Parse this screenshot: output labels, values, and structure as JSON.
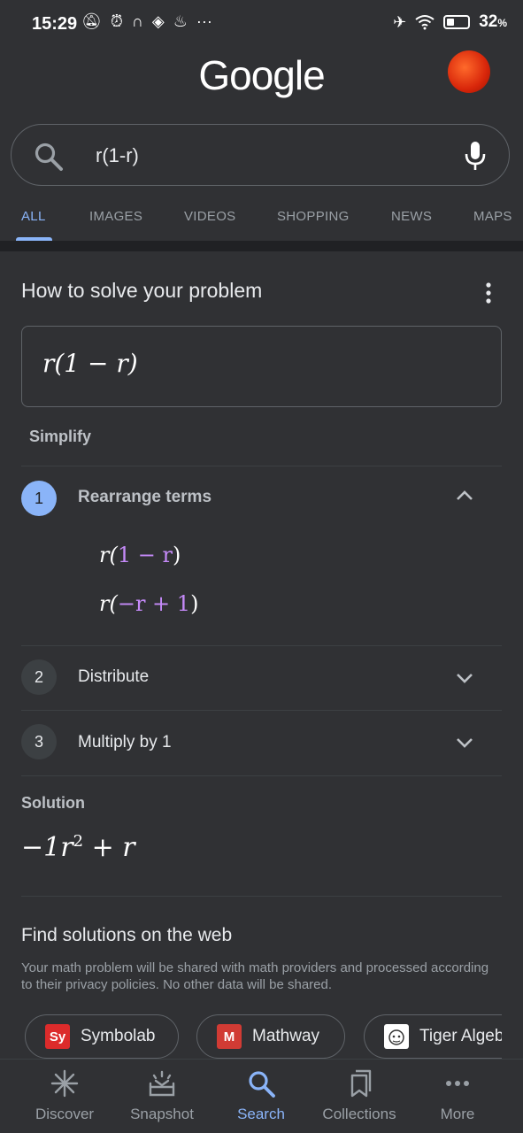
{
  "status_bar": {
    "time": "15:29",
    "battery": "32",
    "battery_unit": "%"
  },
  "header": {
    "logo": "Google"
  },
  "search": {
    "query": "r(1-r)"
  },
  "tabs": [
    {
      "label": "ALL",
      "active": true
    },
    {
      "label": "IMAGES"
    },
    {
      "label": "VIDEOS"
    },
    {
      "label": "SHOPPING"
    },
    {
      "label": "NEWS"
    },
    {
      "label": "MAPS"
    }
  ],
  "solver": {
    "title": "How to solve your problem",
    "expression": "r(1 − r)",
    "mode": "Simplify",
    "steps": [
      {
        "number": "1",
        "label": "Rearrange terms",
        "expanded": true,
        "line1_a": "r(",
        "line1_b": "1 − r",
        "line1_c": ")",
        "line2_a": "r(",
        "line2_b": "−r + 1",
        "line2_c": ")"
      },
      {
        "number": "2",
        "label": "Distribute",
        "expanded": false
      },
      {
        "number": "3",
        "label": "Multiply by 1",
        "expanded": false
      }
    ],
    "solution_label": "Solution",
    "solution_a": "−1r",
    "solution_exp": "2",
    "solution_b": " + r"
  },
  "web_solutions": {
    "title": "Find solutions on the web",
    "description": "Your math problem will be shared with math providers and processed according to their privacy policies. No other data will be shared.",
    "providers": [
      {
        "name": "Symbolab",
        "logo_text": "Sy"
      },
      {
        "name": "Mathway",
        "logo_text": "M"
      },
      {
        "name": "Tiger Algebra",
        "logo_text": ""
      }
    ]
  },
  "bottom_nav": [
    {
      "label": "Discover",
      "icon": "asterisk-icon"
    },
    {
      "label": "Snapshot",
      "icon": "snapshot-icon"
    },
    {
      "label": "Search",
      "icon": "search-icon",
      "active": true
    },
    {
      "label": "Collections",
      "icon": "bookmarks-icon"
    },
    {
      "label": "More",
      "icon": "more-dots-icon"
    }
  ],
  "colors": {
    "background": "#303134",
    "accent": "#8ab4f8",
    "math_highlight": "#c58af9",
    "symbolab": "#dc2b2b",
    "mathway": "#d13b34"
  }
}
